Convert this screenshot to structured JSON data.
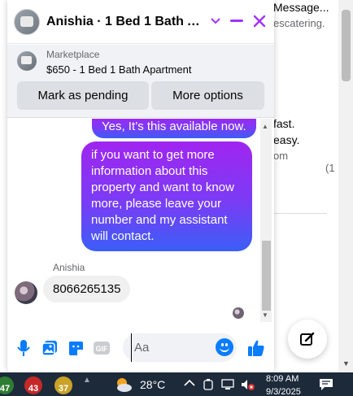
{
  "background_page": {
    "line1": "Message...",
    "line2": "escatering.",
    "line3": "fast.",
    "line4": "easy.",
    "line5": "om",
    "line6": "(1"
  },
  "chat": {
    "title": "Anishia · 1 Bed 1 Bath Apar...",
    "listing": {
      "label": "Marketplace",
      "description": "$650 - 1 Bed 1 Bath Apartment",
      "mark_pending": "Mark as pending",
      "more_options": "More options"
    },
    "messages": [
      {
        "from": "me",
        "text": "Yes, It’s this available now."
      },
      {
        "from": "me",
        "text": "if you want to get more information about this property and want to know more, please leave your number and my assistant will contact."
      },
      {
        "from": "Anishia",
        "text": "8066265135"
      }
    ],
    "sender_name": "Anishia",
    "composer": {
      "placeholder": "Aa"
    }
  },
  "taskbar": {
    "badges": [
      {
        "value": "47",
        "color": "#2e7d32"
      },
      {
        "value": "43",
        "color": "#c62828"
      },
      {
        "value": "37",
        "color": "#c9a227"
      }
    ],
    "temperature": "28°C",
    "time": "8:09 AM",
    "date": "9/3/2025"
  },
  "colors": {
    "messenger_blue": "#0a7cff",
    "messenger_purple": "#a033ff",
    "taskbar": "#1c2a3a"
  }
}
